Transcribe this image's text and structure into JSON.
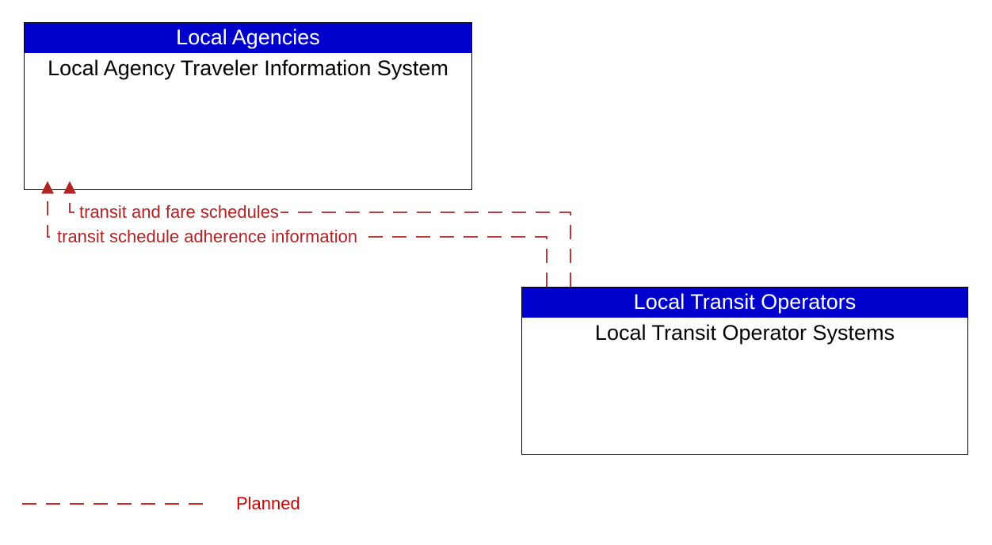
{
  "nodes": {
    "top": {
      "header": "Local Agencies",
      "body": "Local Agency Traveler Information System"
    },
    "bottom": {
      "header": "Local Transit Operators",
      "body": "Local Transit Operator Systems"
    }
  },
  "flows": {
    "flow1": "transit and fare schedules",
    "flow2": "transit schedule adherence information"
  },
  "legend": {
    "planned": "Planned"
  },
  "colors": {
    "header_bg": "#0000cc",
    "flow_stroke": "#b22222"
  },
  "chart_data": {
    "type": "diagram",
    "nodes": [
      {
        "id": "la-tis",
        "owner": "Local Agencies",
        "label": "Local Agency Traveler Information System"
      },
      {
        "id": "lto-sys",
        "owner": "Local Transit Operators",
        "label": "Local Transit Operator Systems"
      }
    ],
    "edges": [
      {
        "from": "lto-sys",
        "to": "la-tis",
        "label": "transit and fare schedules",
        "status": "Planned"
      },
      {
        "from": "lto-sys",
        "to": "la-tis",
        "label": "transit schedule adherence information",
        "status": "Planned"
      }
    ],
    "legend": [
      {
        "style": "dashed-red",
        "meaning": "Planned"
      }
    ]
  }
}
